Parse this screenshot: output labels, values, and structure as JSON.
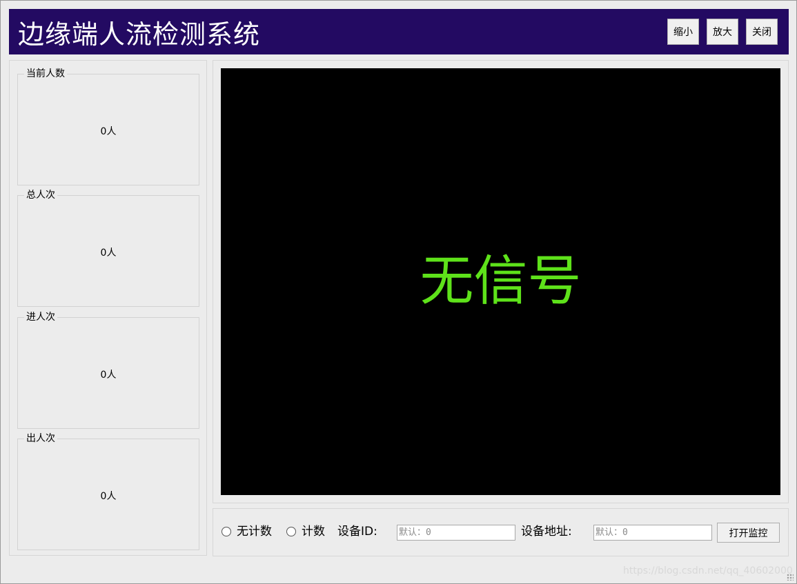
{
  "header": {
    "title": "边缘端人流检测系统",
    "buttons": {
      "shrink": "缩小",
      "enlarge": "放大",
      "close": "关闭"
    },
    "background_color": "#230a62"
  },
  "stats": [
    {
      "title": "当前人数",
      "value": "0人"
    },
    {
      "title": "总人次",
      "value": "0人"
    },
    {
      "title": "进人次",
      "value": "0人"
    },
    {
      "title": "出人次",
      "value": "0人"
    }
  ],
  "video": {
    "status_text": "无信号",
    "status_color": "#5ee21a",
    "background": "#000000"
  },
  "controls": {
    "radio_no_count": "无计数",
    "radio_count": "计数",
    "device_id_label": "设备ID:",
    "device_id_placeholder": "默认：0",
    "device_addr_label": "设备地址:",
    "device_addr_placeholder": "默认：0",
    "open_button": "打开监控"
  },
  "watermark": "https://blog.csdn.net/qq_40602000"
}
